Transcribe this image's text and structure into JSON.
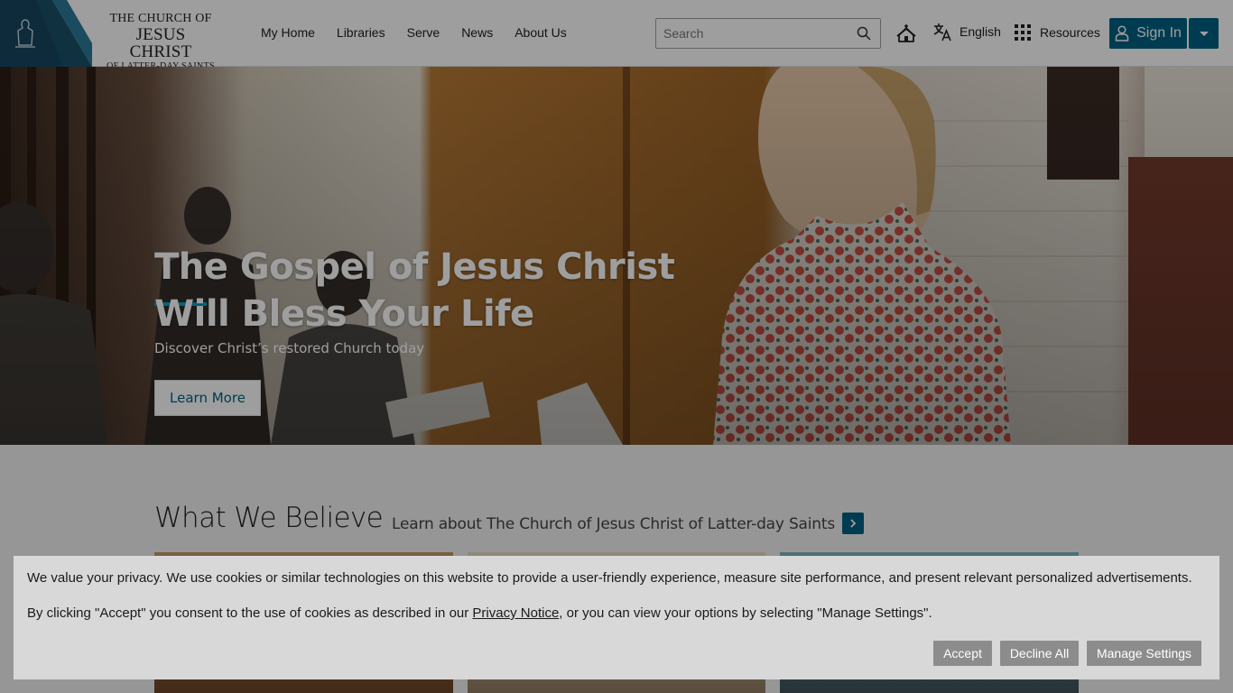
{
  "header": {
    "logo": {
      "line1": "THE CHURCH OF",
      "line2": "JESUS CHRIST",
      "line3": "OF LATTER-DAY SAINTS"
    },
    "nav": [
      "My Home",
      "Libraries",
      "Serve",
      "News",
      "About Us"
    ],
    "search_placeholder": "Search",
    "language": "English",
    "resources": "Resources",
    "sign_in": "Sign In"
  },
  "hero": {
    "title": "The Gospel of Jesus Christ Will Bless Your Life",
    "subtitle": "Discover Christ’s restored Church today",
    "button": "Learn More"
  },
  "believe": {
    "title": "What We Believe",
    "subtitle": "Learn about The Church of Jesus Christ of Latter-day Saints"
  },
  "cookie": {
    "line1": "We value your privacy. We use cookies or similar technologies on this website to provide a user-friendly experience, measure site performance, and present relevant personalized advertisements.",
    "line2_pre": "By clicking \"Accept\" you consent to the use of cookies as described in our ",
    "link": "Privacy Notice",
    "line2_post": ", or you can view your options by selecting \"Manage Settings\".",
    "accept": "Accept",
    "decline": "Decline All",
    "manage": "Manage Settings"
  },
  "colors": {
    "brand": "#006184",
    "accent": "#00a7c4",
    "logo_badge": "#1f5d78"
  }
}
